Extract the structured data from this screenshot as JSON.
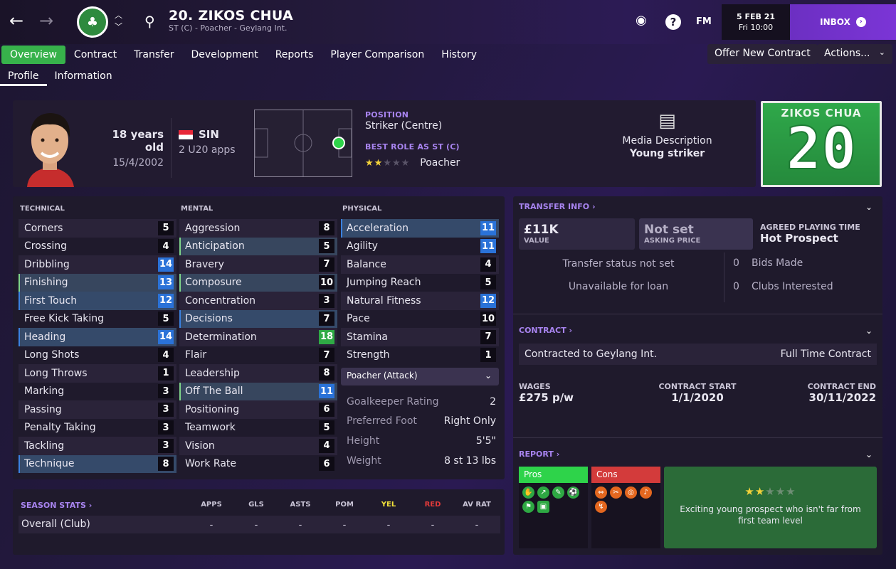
{
  "header": {
    "name": "20. ZIKOS CHUA",
    "subtitle": "ST (C) - Poacher - Geylang Int.",
    "date": "5 FEB 21",
    "time": "Fri 10:00",
    "inbox": "INBOX",
    "fm": "FM"
  },
  "tabs": [
    "Overview",
    "Contract",
    "Transfer",
    "Development",
    "Reports",
    "Player Comparison",
    "History"
  ],
  "subtabs": [
    "Profile",
    "Information"
  ],
  "buttons": {
    "offer": "Offer New Contract",
    "actions": "Actions..."
  },
  "profile": {
    "age": "18 years old",
    "dob": "15/4/2002",
    "nation": "SIN",
    "apps": "2 U20 apps",
    "position_label": "POSITION",
    "position": "Striker (Centre)",
    "role_label": "BEST ROLE AS ST (C)",
    "role": "Poacher",
    "role_stars": 2,
    "media_label": "Media Description",
    "media": "Young striker",
    "kit_name": "ZIKOS CHUA",
    "kit_number": "20"
  },
  "attributes": {
    "technical_label": "TECHNICAL",
    "mental_label": "MENTAL",
    "physical_label": "PHYSICAL",
    "technical": [
      [
        "Corners",
        "5"
      ],
      [
        "Crossing",
        "4"
      ],
      [
        "Dribbling",
        "14"
      ],
      [
        "Finishing",
        "13"
      ],
      [
        "First Touch",
        "12"
      ],
      [
        "Free Kick Taking",
        "5"
      ],
      [
        "Heading",
        "14"
      ],
      [
        "Long Shots",
        "4"
      ],
      [
        "Long Throws",
        "1"
      ],
      [
        "Marking",
        "3"
      ],
      [
        "Passing",
        "3"
      ],
      [
        "Penalty Taking",
        "3"
      ],
      [
        "Tackling",
        "3"
      ],
      [
        "Technique",
        "8"
      ]
    ],
    "mental": [
      [
        "Aggression",
        "8"
      ],
      [
        "Anticipation",
        "5"
      ],
      [
        "Bravery",
        "7"
      ],
      [
        "Composure",
        "10"
      ],
      [
        "Concentration",
        "3"
      ],
      [
        "Decisions",
        "7"
      ],
      [
        "Determination",
        "18"
      ],
      [
        "Flair",
        "7"
      ],
      [
        "Leadership",
        "8"
      ],
      [
        "Off The Ball",
        "11"
      ],
      [
        "Positioning",
        "6"
      ],
      [
        "Teamwork",
        "5"
      ],
      [
        "Vision",
        "4"
      ],
      [
        "Work Rate",
        "6"
      ]
    ],
    "physical": [
      [
        "Acceleration",
        "11"
      ],
      [
        "Agility",
        "11"
      ],
      [
        "Balance",
        "4"
      ],
      [
        "Jumping Reach",
        "5"
      ],
      [
        "Natural Fitness",
        "12"
      ],
      [
        "Pace",
        "10"
      ],
      [
        "Stamina",
        "7"
      ],
      [
        "Strength",
        "1"
      ]
    ]
  },
  "role_dropdown": "Poacher (Attack)",
  "details": [
    [
      "Goalkeeper Rating",
      "2"
    ],
    [
      "Preferred Foot",
      "Right Only"
    ],
    [
      "Height",
      "5'5\""
    ],
    [
      "Weight",
      "8 st 13 lbs"
    ]
  ],
  "season": {
    "label": "SEASON STATS",
    "cols": [
      "APPS",
      "GLS",
      "ASTS",
      "POM",
      "YEL",
      "RED",
      "AV RAT"
    ],
    "row_label": "Overall (Club)",
    "values": [
      "-",
      "-",
      "-",
      "-",
      "-",
      "-",
      "-"
    ]
  },
  "transfer": {
    "label": "TRANSFER INFO",
    "value": "£11K",
    "value_label": "VALUE",
    "asking": "Not set",
    "asking_label": "ASKING PRICE",
    "pt_label": "AGREED PLAYING TIME",
    "pt": "Hot Prospect",
    "status": "Transfer status not set",
    "loan": "Unavailable for loan",
    "bids_n": "0",
    "bids": "Bids Made",
    "clubs_n": "0",
    "clubs": "Clubs Interested"
  },
  "contract": {
    "label": "CONTRACT",
    "to": "Contracted to Geylang Int.",
    "type": "Full Time Contract",
    "wages_label": "WAGES",
    "wages": "£275 p/w",
    "start_label": "CONTRACT START",
    "start": "1/1/2020",
    "end_label": "CONTRACT END",
    "end": "30/11/2022"
  },
  "report": {
    "label": "REPORT",
    "pros": "Pros",
    "cons": "Cons",
    "stars": 2,
    "text": "Exciting young prospect who isn't far from first team level"
  },
  "colors": {
    "accent": "#37b24b",
    "purple": "#7b35d6",
    "blue": "#2a72d8",
    "pros": "#2ed34a",
    "cons": "#d33b3b"
  }
}
